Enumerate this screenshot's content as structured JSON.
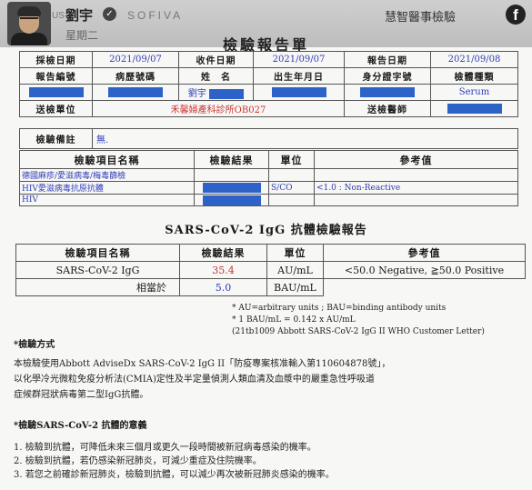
{
  "header": {
    "user_name": "劉宇",
    "verified_mark": "✓",
    "brand_prefix": "US",
    "brand": "SOFIVA",
    "weekday": "星期二",
    "clinic": "慧智醫事檢驗",
    "facebook_glyph": "f"
  },
  "report": {
    "title": "檢驗報告單",
    "labels": {
      "collect_date": "採檢日期",
      "receive_date": "收件日期",
      "report_date": "報告日期",
      "report_no": "報告編號",
      "chart_no": "病歷號碼",
      "name": "姓　名",
      "birth": "出生年月日",
      "id_no": "身分證字號",
      "specimen": "檢體種類",
      "sender": "送檢單位",
      "doctor": "送檢醫師",
      "remark": "檢驗備註"
    },
    "values": {
      "collect_date": "2021/09/07",
      "receive_date": "2021/09/07",
      "report_date": "2021/09/08",
      "name": "劉宇",
      "specimen": "Serum",
      "sender": "禾馨婦產科診所OB027",
      "remark": "無."
    }
  },
  "tests": {
    "headers": [
      "檢驗項目名稱",
      "檢驗結果",
      "單位",
      "參考值"
    ],
    "rows": [
      {
        "name": "德國麻疹/愛滋病毒/梅毒篩檢",
        "unit": "",
        "ref": ""
      },
      {
        "name": "HIV愛滋病毒抗原抗體",
        "unit": "S/CO",
        "ref": "<1.0 : Non-Reactive"
      },
      {
        "name": "HIV",
        "unit": "",
        "ref": ""
      }
    ]
  },
  "sars": {
    "title": "SARS-CoV-2 IgG 抗體檢驗報告",
    "headers": [
      "檢驗項目名稱",
      "檢驗結果",
      "單位",
      "參考值"
    ],
    "row1": {
      "name": "SARS-CoV-2 IgG",
      "result": "35.4",
      "unit": "AU/mL",
      "ref": "<50.0 Negative, ≧50.0 Positive"
    },
    "row2": {
      "name": "相當於",
      "result": "5.0",
      "unit": "BAU/mL"
    },
    "notes": [
      "* AU=arbitrary units ; BAU=binding antibody units",
      "* 1 BAU/mL = 0.142 x AU/mL",
      "(21tb1009 Abbott SARS-CoV-2 IgG II WHO Customer Letter)"
    ]
  },
  "method": {
    "title": "*檢驗方式",
    "lines": [
      "本檢驗使用Abbott AdviseDx SARS-CoV-2 IgG II「防疫專案核准輸入第110604878號」，",
      "以化學冷光微粒免疫分析法(CMIA)定性及半定量偵測人類血清及血漿中的嚴重急性呼吸道",
      "症候群冠狀病毒第二型IgG抗體。"
    ]
  },
  "meaning": {
    "title": "*檢驗SARS-CoV-2 抗體的意義",
    "lines": [
      "1. 檢驗到抗體，可降低未來三個月或更久一段時間被新冠病毒感染的機率。",
      "2. 檢驗到抗體，若仍感染新冠肺炎，可減少重症及住院機率。",
      "3. 若您之前確診新冠肺炎，檢驗到抗體，可以減少再次被新冠肺炎感染的機率。"
    ]
  }
}
